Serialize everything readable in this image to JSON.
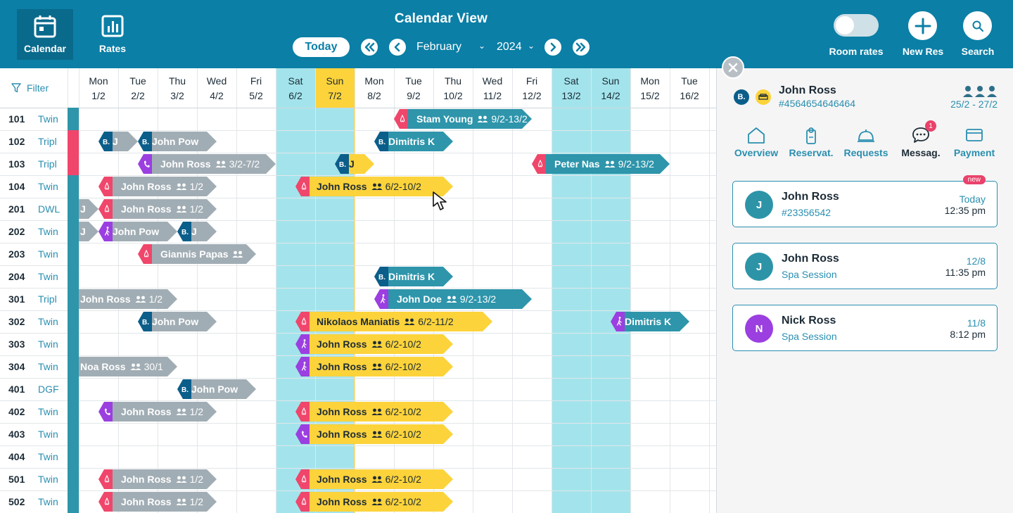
{
  "header": {
    "title": "Calendar View",
    "nav_calendar": "Calendar",
    "nav_rates": "Rates",
    "today_label": "Today",
    "month": "February",
    "year": "2024",
    "room_rates_label": "Room rates",
    "new_res_label": "New Res",
    "search_label": "Search"
  },
  "grid": {
    "filter_label": "Filter",
    "days": [
      {
        "d": "Mon",
        "n": "1/2"
      },
      {
        "d": "Tue",
        "n": "2/2"
      },
      {
        "d": "Thu",
        "n": "3/2"
      },
      {
        "d": "Wed",
        "n": "4/2"
      },
      {
        "d": "Fri",
        "n": "5/2"
      },
      {
        "d": "Sat",
        "n": "6/2"
      },
      {
        "d": "Sun",
        "n": "7/2"
      },
      {
        "d": "Mon",
        "n": "8/2"
      },
      {
        "d": "Tue",
        "n": "9/2"
      },
      {
        "d": "Thu",
        "n": "10/2"
      },
      {
        "d": "Wed",
        "n": "11/2"
      },
      {
        "d": "Fri",
        "n": "12/2"
      },
      {
        "d": "Sat",
        "n": "13/2"
      },
      {
        "d": "Sun",
        "n": "14/2"
      },
      {
        "d": "Mon",
        "n": "15/2"
      },
      {
        "d": "Tue",
        "n": "16/2"
      }
    ],
    "rooms": [
      {
        "num": "101",
        "type": "Twin",
        "status": "teal"
      },
      {
        "num": "102",
        "type": "Tripl",
        "status": "pink"
      },
      {
        "num": "103",
        "type": "Tripl",
        "status": "pink"
      },
      {
        "num": "104",
        "type": "Twin",
        "status": "teal"
      },
      {
        "num": "201",
        "type": "DWL",
        "status": "teal"
      },
      {
        "num": "202",
        "type": "Twin",
        "status": "teal"
      },
      {
        "num": "203",
        "type": "Twin",
        "status": "teal"
      },
      {
        "num": "204",
        "type": "Twin",
        "status": "teal"
      },
      {
        "num": "301",
        "type": "Tripl",
        "status": "teal"
      },
      {
        "num": "302",
        "type": "Twin",
        "status": "teal"
      },
      {
        "num": "303",
        "type": "Twin",
        "status": "teal"
      },
      {
        "num": "304",
        "type": "Twin",
        "status": "teal"
      },
      {
        "num": "401",
        "type": "DGF",
        "status": "teal"
      },
      {
        "num": "402",
        "type": "Twin",
        "status": "teal"
      },
      {
        "num": "403",
        "type": "Twin",
        "status": "teal"
      },
      {
        "num": "404",
        "type": "Twin",
        "status": "teal"
      },
      {
        "num": "501",
        "type": "Twin",
        "status": "teal"
      },
      {
        "num": "502",
        "type": "Twin",
        "status": "teal"
      }
    ],
    "bookings": [
      {
        "row": 0,
        "from": 8,
        "to": 11.5,
        "name": "Stam Young",
        "guests": "9/2-13/2",
        "color": "teal",
        "src": "airbnb"
      },
      {
        "row": 1,
        "from": 0.5,
        "to": 1.5,
        "name": "J",
        "guests": "",
        "color": "gray",
        "src": "booking"
      },
      {
        "row": 1,
        "from": 1.5,
        "to": 3.5,
        "name": "John Pow",
        "guests": "",
        "color": "gray",
        "src": "booking"
      },
      {
        "row": 1,
        "from": 7.5,
        "to": 9.5,
        "name": "Dimitris K",
        "guests": "",
        "color": "teal",
        "src": "booking"
      },
      {
        "row": 2,
        "from": 1.5,
        "to": 5,
        "name": "John Ross",
        "guests": "3/2-7/2",
        "color": "gray",
        "src": "phone"
      },
      {
        "row": 2,
        "from": 6.5,
        "to": 7.5,
        "name": "J",
        "guests": "",
        "color": "yellow",
        "src": "booking"
      },
      {
        "row": 2,
        "from": 11.5,
        "to": 15,
        "name": "Peter Nas",
        "guests": "9/2-13/2",
        "color": "teal",
        "src": "airbnb"
      },
      {
        "row": 3,
        "from": 0.5,
        "to": 3.5,
        "name": "John Ross",
        "guests": "1/2",
        "color": "gray",
        "src": "airbnb"
      },
      {
        "row": 3,
        "from": 5.5,
        "to": 9.5,
        "name": "John Ross",
        "guests": "6/2-10/2",
        "color": "yellow",
        "src": "airbnb"
      },
      {
        "row": 4,
        "from": 0,
        "to": 0.5,
        "name": "J",
        "guests": "",
        "color": "gray",
        "src": "none"
      },
      {
        "row": 4,
        "from": 0.5,
        "to": 3.5,
        "name": "John Ross",
        "guests": "1/2",
        "color": "gray",
        "src": "airbnb"
      },
      {
        "row": 5,
        "from": 0,
        "to": 0.5,
        "name": "J",
        "guests": "",
        "color": "gray",
        "src": "none"
      },
      {
        "row": 5,
        "from": 0.5,
        "to": 2.5,
        "name": "John Pow",
        "guests": "",
        "color": "gray",
        "src": "walk"
      },
      {
        "row": 5,
        "from": 2.5,
        "to": 3.5,
        "name": "J",
        "guests": "",
        "color": "gray",
        "src": "booking"
      },
      {
        "row": 6,
        "from": 1.5,
        "to": 4.5,
        "name": "Giannis Papas",
        "guests": " ",
        "color": "gray",
        "src": "airbnb"
      },
      {
        "row": 7,
        "from": 7.5,
        "to": 9.5,
        "name": "Dimitris K",
        "guests": "",
        "color": "teal",
        "src": "booking"
      },
      {
        "row": 8,
        "from": 0,
        "to": 2.5,
        "name": "John Ross",
        "guests": "1/2",
        "color": "gray",
        "src": "none"
      },
      {
        "row": 8,
        "from": 7.5,
        "to": 11.5,
        "name": "John Doe",
        "guests": "9/2-13/2",
        "color": "teal",
        "src": "walk"
      },
      {
        "row": 9,
        "from": 1.5,
        "to": 3.5,
        "name": "John Pow",
        "guests": "",
        "color": "gray",
        "src": "booking"
      },
      {
        "row": 9,
        "from": 5.5,
        "to": 10.5,
        "name": "Nikolaos Maniatis",
        "guests": "6/2-11/2",
        "color": "yellow",
        "src": "airbnb"
      },
      {
        "row": 9,
        "from": 13.5,
        "to": 15.5,
        "name": "Dimitris K",
        "guests": "",
        "color": "teal",
        "src": "walk"
      },
      {
        "row": 10,
        "from": 5.5,
        "to": 9.5,
        "name": "John Ross",
        "guests": "6/2-10/2",
        "color": "yellow",
        "src": "walk"
      },
      {
        "row": 11,
        "from": 0,
        "to": 2.5,
        "name": "Noa Ross",
        "guests": "30/1",
        "color": "gray",
        "src": "none"
      },
      {
        "row": 11,
        "from": 5.5,
        "to": 9.5,
        "name": "John Ross",
        "guests": "6/2-10/2",
        "color": "yellow",
        "src": "walk"
      },
      {
        "row": 12,
        "from": 2.5,
        "to": 4.5,
        "name": "John Pow",
        "guests": "",
        "color": "gray",
        "src": "booking"
      },
      {
        "row": 13,
        "from": 0.5,
        "to": 3.5,
        "name": "John Ross",
        "guests": "1/2",
        "color": "gray",
        "src": "phone"
      },
      {
        "row": 13,
        "from": 5.5,
        "to": 9.5,
        "name": "John Ross",
        "guests": "6/2-10/2",
        "color": "yellow",
        "src": "airbnb"
      },
      {
        "row": 14,
        "from": 5.5,
        "to": 9.5,
        "name": "John Ross",
        "guests": "6/2-10/2",
        "color": "yellow",
        "src": "phone"
      },
      {
        "row": 16,
        "from": 0.5,
        "to": 3.5,
        "name": "John Ross",
        "guests": "1/2",
        "color": "gray",
        "src": "airbnb"
      },
      {
        "row": 16,
        "from": 5.5,
        "to": 9.5,
        "name": "John Ross",
        "guests": "6/2-10/2",
        "color": "yellow",
        "src": "airbnb"
      },
      {
        "row": 17,
        "from": 0.5,
        "to": 3.5,
        "name": "John Ross",
        "guests": "1/2",
        "color": "gray",
        "src": "airbnb"
      },
      {
        "row": 17,
        "from": 5.5,
        "to": 9.5,
        "name": "John Ross",
        "guests": "6/2-10/2",
        "color": "yellow",
        "src": "airbnb"
      }
    ]
  },
  "panel": {
    "guest_name": "John Ross",
    "guest_id": "#4564654646464",
    "dates": "25/2 - 27/2",
    "tabs": [
      {
        "label": "Overview"
      },
      {
        "label": "Reservat."
      },
      {
        "label": "Requests"
      },
      {
        "label": "Messag.",
        "badge": "1"
      },
      {
        "label": "Payment"
      }
    ],
    "messages": [
      {
        "initial": "J",
        "name": "John Ross",
        "sub": "#23356542",
        "d1": "Today",
        "d2": "12:35 pm",
        "new": "new",
        "color": "#2d94a8"
      },
      {
        "initial": "J",
        "name": "John Ross",
        "sub": "Spa Session",
        "d1": "12/8",
        "d2": "11:35 pm",
        "new": "",
        "color": "#2d94a8"
      },
      {
        "initial": "N",
        "name": "Nick Ross",
        "sub": "Spa Session",
        "d1": "11/8",
        "d2": "8:12 pm",
        "new": "",
        "color": "#9b3fe0"
      }
    ]
  },
  "colors": {
    "header": "#0b7fa6",
    "teal_booking": "#2e95ab",
    "gray_booking": "#a1adb4",
    "yellow_booking": "#fcd33b",
    "weekend": "#a3e4ec",
    "today": "#fcd33b",
    "airbnb": "#f0466b",
    "booking": "#0b5e8a",
    "phone": "#9b3fe0",
    "walk": "#9b3fe0"
  }
}
